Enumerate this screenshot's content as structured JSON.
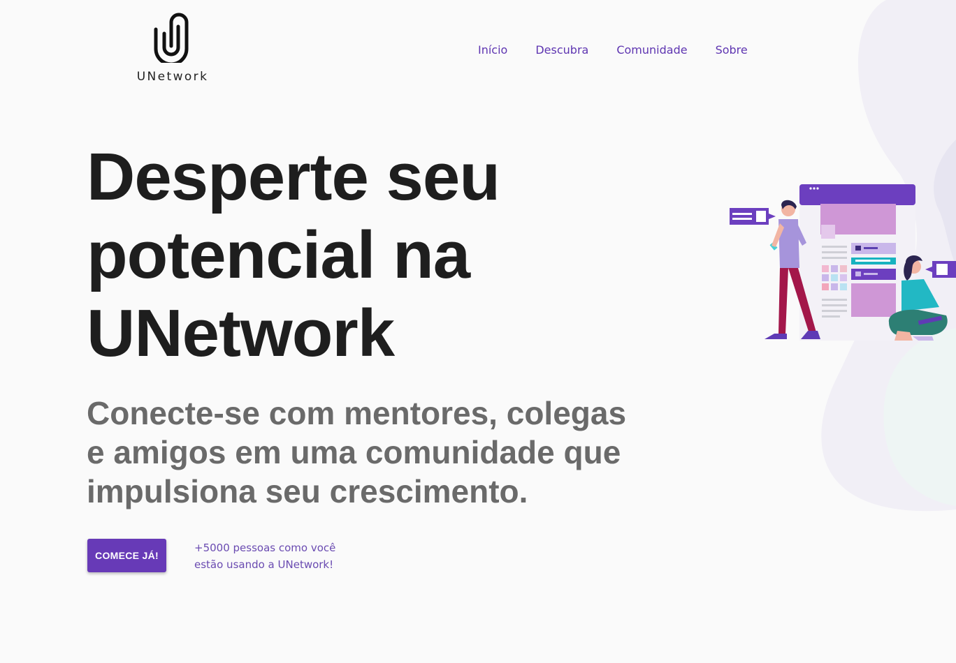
{
  "brand": {
    "name": "UNetwork",
    "logo_icon": "paperclip-u-icon"
  },
  "nav": {
    "items": [
      {
        "label": "Início"
      },
      {
        "label": "Descubra"
      },
      {
        "label": "Comunidade"
      },
      {
        "label": "Sobre"
      }
    ]
  },
  "hero": {
    "title_lines": [
      "Desperte seu",
      "potencial na",
      "UNetwork"
    ],
    "subtitle_lines": [
      "Conecte-se com mentores, colegas",
      "e amigos em uma comunidade que",
      "impulsiona seu crescimento."
    ],
    "cta_label": "COMECE JÁ!",
    "users_note_lines": [
      "+5000 pessoas como você",
      "estão usando a UNetwork!"
    ]
  },
  "illustration": {
    "icon": "people-with-web-page-illustration"
  },
  "colors": {
    "primary": "#673ab7",
    "nav_link": "#5e35b1",
    "heading": "#1e1e1e",
    "subtitle": "#6a6a6a",
    "background": "#fafafa"
  }
}
